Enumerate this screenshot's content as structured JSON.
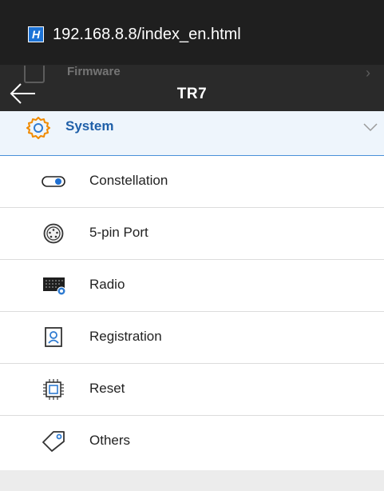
{
  "browser": {
    "site_badge": "H",
    "url": "192.168.8.8/index_en.html"
  },
  "appbar": {
    "title": "TR7",
    "ghost_item_label": "Firmware"
  },
  "section": {
    "label": "System",
    "expanded": true
  },
  "menu": {
    "items": [
      {
        "label": "Constellation",
        "icon": "toggle-icon"
      },
      {
        "label": "5-pin Port",
        "icon": "port-icon"
      },
      {
        "label": "Radio",
        "icon": "radio-icon"
      },
      {
        "label": "Registration",
        "icon": "registration-icon"
      },
      {
        "label": "Reset",
        "icon": "chip-icon"
      },
      {
        "label": "Others",
        "icon": "tag-icon"
      }
    ]
  },
  "colors": {
    "accent": "#1f5fa8",
    "header_bg": "#eef5fc",
    "divider": "#dcdcdc",
    "toolbar": "#2a2a2a",
    "urlbar": "#1f1f1f"
  }
}
